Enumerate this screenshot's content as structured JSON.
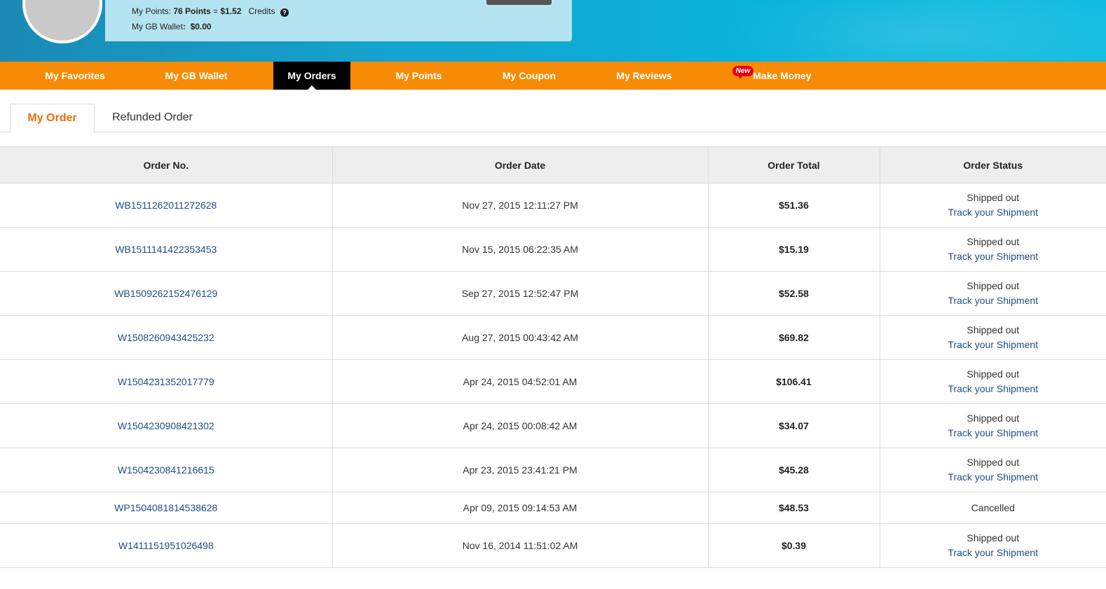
{
  "account": {
    "points_label": "My Points:",
    "points_value": "76 Points",
    "equals": "=",
    "points_money": "$1.52",
    "credits_label": "Credits",
    "help_glyph": "?",
    "wallet_label": "My GB Wallet",
    "wallet_colon": ":",
    "wallet_value": "$0.00"
  },
  "nav": {
    "items": [
      {
        "label": "My Favorites"
      },
      {
        "label": "My GB Wallet"
      },
      {
        "label": "My Orders",
        "active": true
      },
      {
        "label": "My Points"
      },
      {
        "label": "My Coupon"
      },
      {
        "label": "My Reviews"
      },
      {
        "label": "Make Money",
        "badge": "New"
      }
    ]
  },
  "tabs": [
    {
      "label": "My Order",
      "active": true
    },
    {
      "label": "Refunded Order"
    }
  ],
  "table": {
    "headers": [
      "Order No.",
      "Order Date",
      "Order Total",
      "Order Status"
    ],
    "rows": [
      {
        "order_no": "WB1511262011272628",
        "date": "Nov 27, 2015 12:11:27 PM",
        "total": "$51.36",
        "status": "Shipped out",
        "link": "Track your Shipment"
      },
      {
        "order_no": "WB1511141422353453",
        "date": "Nov 15, 2015 06:22:35 AM",
        "total": "$15.19",
        "status": "Shipped out",
        "link": "Track your Shipment"
      },
      {
        "order_no": "WB1509262152476129",
        "date": "Sep 27, 2015 12:52:47 PM",
        "total": "$52.58",
        "status": "Shipped out",
        "link": "Track your Shipment"
      },
      {
        "order_no": "W1508260943425232",
        "date": "Aug 27, 2015 00:43:42 AM",
        "total": "$69.82",
        "status": "Shipped out",
        "link": "Track your Shipment"
      },
      {
        "order_no": "W1504231352017779",
        "date": "Apr 24, 2015 04:52:01 AM",
        "total": "$106.41",
        "status": "Shipped out",
        "link": "Track your Shipment"
      },
      {
        "order_no": "W1504230908421302",
        "date": "Apr 24, 2015 00:08:42 AM",
        "total": "$34.07",
        "status": "Shipped out",
        "link": "Track your Shipment"
      },
      {
        "order_no": "W1504230841216615",
        "date": "Apr 23, 2015 23:41:21 PM",
        "total": "$45.28",
        "status": "Shipped out",
        "link": "Track your Shipment"
      },
      {
        "order_no": "WP1504081814538628",
        "date": "Apr 09, 2015 09:14:53 AM",
        "total": "$48.53",
        "status": "Cancelled",
        "link": ""
      },
      {
        "order_no": "W1411151951026498",
        "date": "Nov 16, 2014 11:51:02 AM",
        "total": "$0.39",
        "status": "Shipped out",
        "link": "Track your Shipment"
      }
    ]
  }
}
